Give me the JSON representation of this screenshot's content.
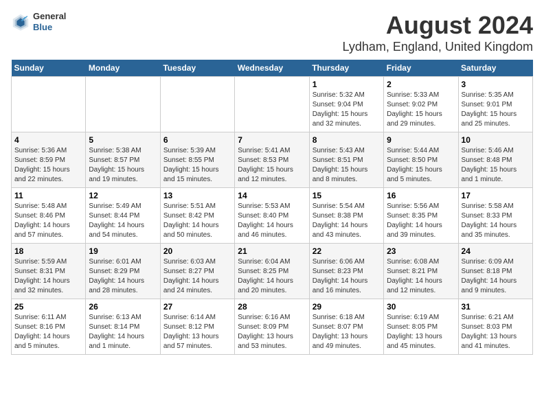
{
  "header": {
    "title": "August 2024",
    "subtitle": "Lydham, England, United Kingdom",
    "logo_line1": "General",
    "logo_line2": "Blue"
  },
  "days_of_week": [
    "Sunday",
    "Monday",
    "Tuesday",
    "Wednesday",
    "Thursday",
    "Friday",
    "Saturday"
  ],
  "weeks": [
    [
      {
        "day": "",
        "info": ""
      },
      {
        "day": "",
        "info": ""
      },
      {
        "day": "",
        "info": ""
      },
      {
        "day": "",
        "info": ""
      },
      {
        "day": "1",
        "info": "Sunrise: 5:32 AM\nSunset: 9:04 PM\nDaylight: 15 hours\nand 32 minutes."
      },
      {
        "day": "2",
        "info": "Sunrise: 5:33 AM\nSunset: 9:02 PM\nDaylight: 15 hours\nand 29 minutes."
      },
      {
        "day": "3",
        "info": "Sunrise: 5:35 AM\nSunset: 9:01 PM\nDaylight: 15 hours\nand 25 minutes."
      }
    ],
    [
      {
        "day": "4",
        "info": "Sunrise: 5:36 AM\nSunset: 8:59 PM\nDaylight: 15 hours\nand 22 minutes."
      },
      {
        "day": "5",
        "info": "Sunrise: 5:38 AM\nSunset: 8:57 PM\nDaylight: 15 hours\nand 19 minutes."
      },
      {
        "day": "6",
        "info": "Sunrise: 5:39 AM\nSunset: 8:55 PM\nDaylight: 15 hours\nand 15 minutes."
      },
      {
        "day": "7",
        "info": "Sunrise: 5:41 AM\nSunset: 8:53 PM\nDaylight: 15 hours\nand 12 minutes."
      },
      {
        "day": "8",
        "info": "Sunrise: 5:43 AM\nSunset: 8:51 PM\nDaylight: 15 hours\nand 8 minutes."
      },
      {
        "day": "9",
        "info": "Sunrise: 5:44 AM\nSunset: 8:50 PM\nDaylight: 15 hours\nand 5 minutes."
      },
      {
        "day": "10",
        "info": "Sunrise: 5:46 AM\nSunset: 8:48 PM\nDaylight: 15 hours\nand 1 minute."
      }
    ],
    [
      {
        "day": "11",
        "info": "Sunrise: 5:48 AM\nSunset: 8:46 PM\nDaylight: 14 hours\nand 57 minutes."
      },
      {
        "day": "12",
        "info": "Sunrise: 5:49 AM\nSunset: 8:44 PM\nDaylight: 14 hours\nand 54 minutes."
      },
      {
        "day": "13",
        "info": "Sunrise: 5:51 AM\nSunset: 8:42 PM\nDaylight: 14 hours\nand 50 minutes."
      },
      {
        "day": "14",
        "info": "Sunrise: 5:53 AM\nSunset: 8:40 PM\nDaylight: 14 hours\nand 46 minutes."
      },
      {
        "day": "15",
        "info": "Sunrise: 5:54 AM\nSunset: 8:38 PM\nDaylight: 14 hours\nand 43 minutes."
      },
      {
        "day": "16",
        "info": "Sunrise: 5:56 AM\nSunset: 8:35 PM\nDaylight: 14 hours\nand 39 minutes."
      },
      {
        "day": "17",
        "info": "Sunrise: 5:58 AM\nSunset: 8:33 PM\nDaylight: 14 hours\nand 35 minutes."
      }
    ],
    [
      {
        "day": "18",
        "info": "Sunrise: 5:59 AM\nSunset: 8:31 PM\nDaylight: 14 hours\nand 32 minutes."
      },
      {
        "day": "19",
        "info": "Sunrise: 6:01 AM\nSunset: 8:29 PM\nDaylight: 14 hours\nand 28 minutes."
      },
      {
        "day": "20",
        "info": "Sunrise: 6:03 AM\nSunset: 8:27 PM\nDaylight: 14 hours\nand 24 minutes."
      },
      {
        "day": "21",
        "info": "Sunrise: 6:04 AM\nSunset: 8:25 PM\nDaylight: 14 hours\nand 20 minutes."
      },
      {
        "day": "22",
        "info": "Sunrise: 6:06 AM\nSunset: 8:23 PM\nDaylight: 14 hours\nand 16 minutes."
      },
      {
        "day": "23",
        "info": "Sunrise: 6:08 AM\nSunset: 8:21 PM\nDaylight: 14 hours\nand 12 minutes."
      },
      {
        "day": "24",
        "info": "Sunrise: 6:09 AM\nSunset: 8:18 PM\nDaylight: 14 hours\nand 9 minutes."
      }
    ],
    [
      {
        "day": "25",
        "info": "Sunrise: 6:11 AM\nSunset: 8:16 PM\nDaylight: 14 hours\nand 5 minutes."
      },
      {
        "day": "26",
        "info": "Sunrise: 6:13 AM\nSunset: 8:14 PM\nDaylight: 14 hours\nand 1 minute."
      },
      {
        "day": "27",
        "info": "Sunrise: 6:14 AM\nSunset: 8:12 PM\nDaylight: 13 hours\nand 57 minutes."
      },
      {
        "day": "28",
        "info": "Sunrise: 6:16 AM\nSunset: 8:09 PM\nDaylight: 13 hours\nand 53 minutes."
      },
      {
        "day": "29",
        "info": "Sunrise: 6:18 AM\nSunset: 8:07 PM\nDaylight: 13 hours\nand 49 minutes."
      },
      {
        "day": "30",
        "info": "Sunrise: 6:19 AM\nSunset: 8:05 PM\nDaylight: 13 hours\nand 45 minutes."
      },
      {
        "day": "31",
        "info": "Sunrise: 6:21 AM\nSunset: 8:03 PM\nDaylight: 13 hours\nand 41 minutes."
      }
    ]
  ]
}
